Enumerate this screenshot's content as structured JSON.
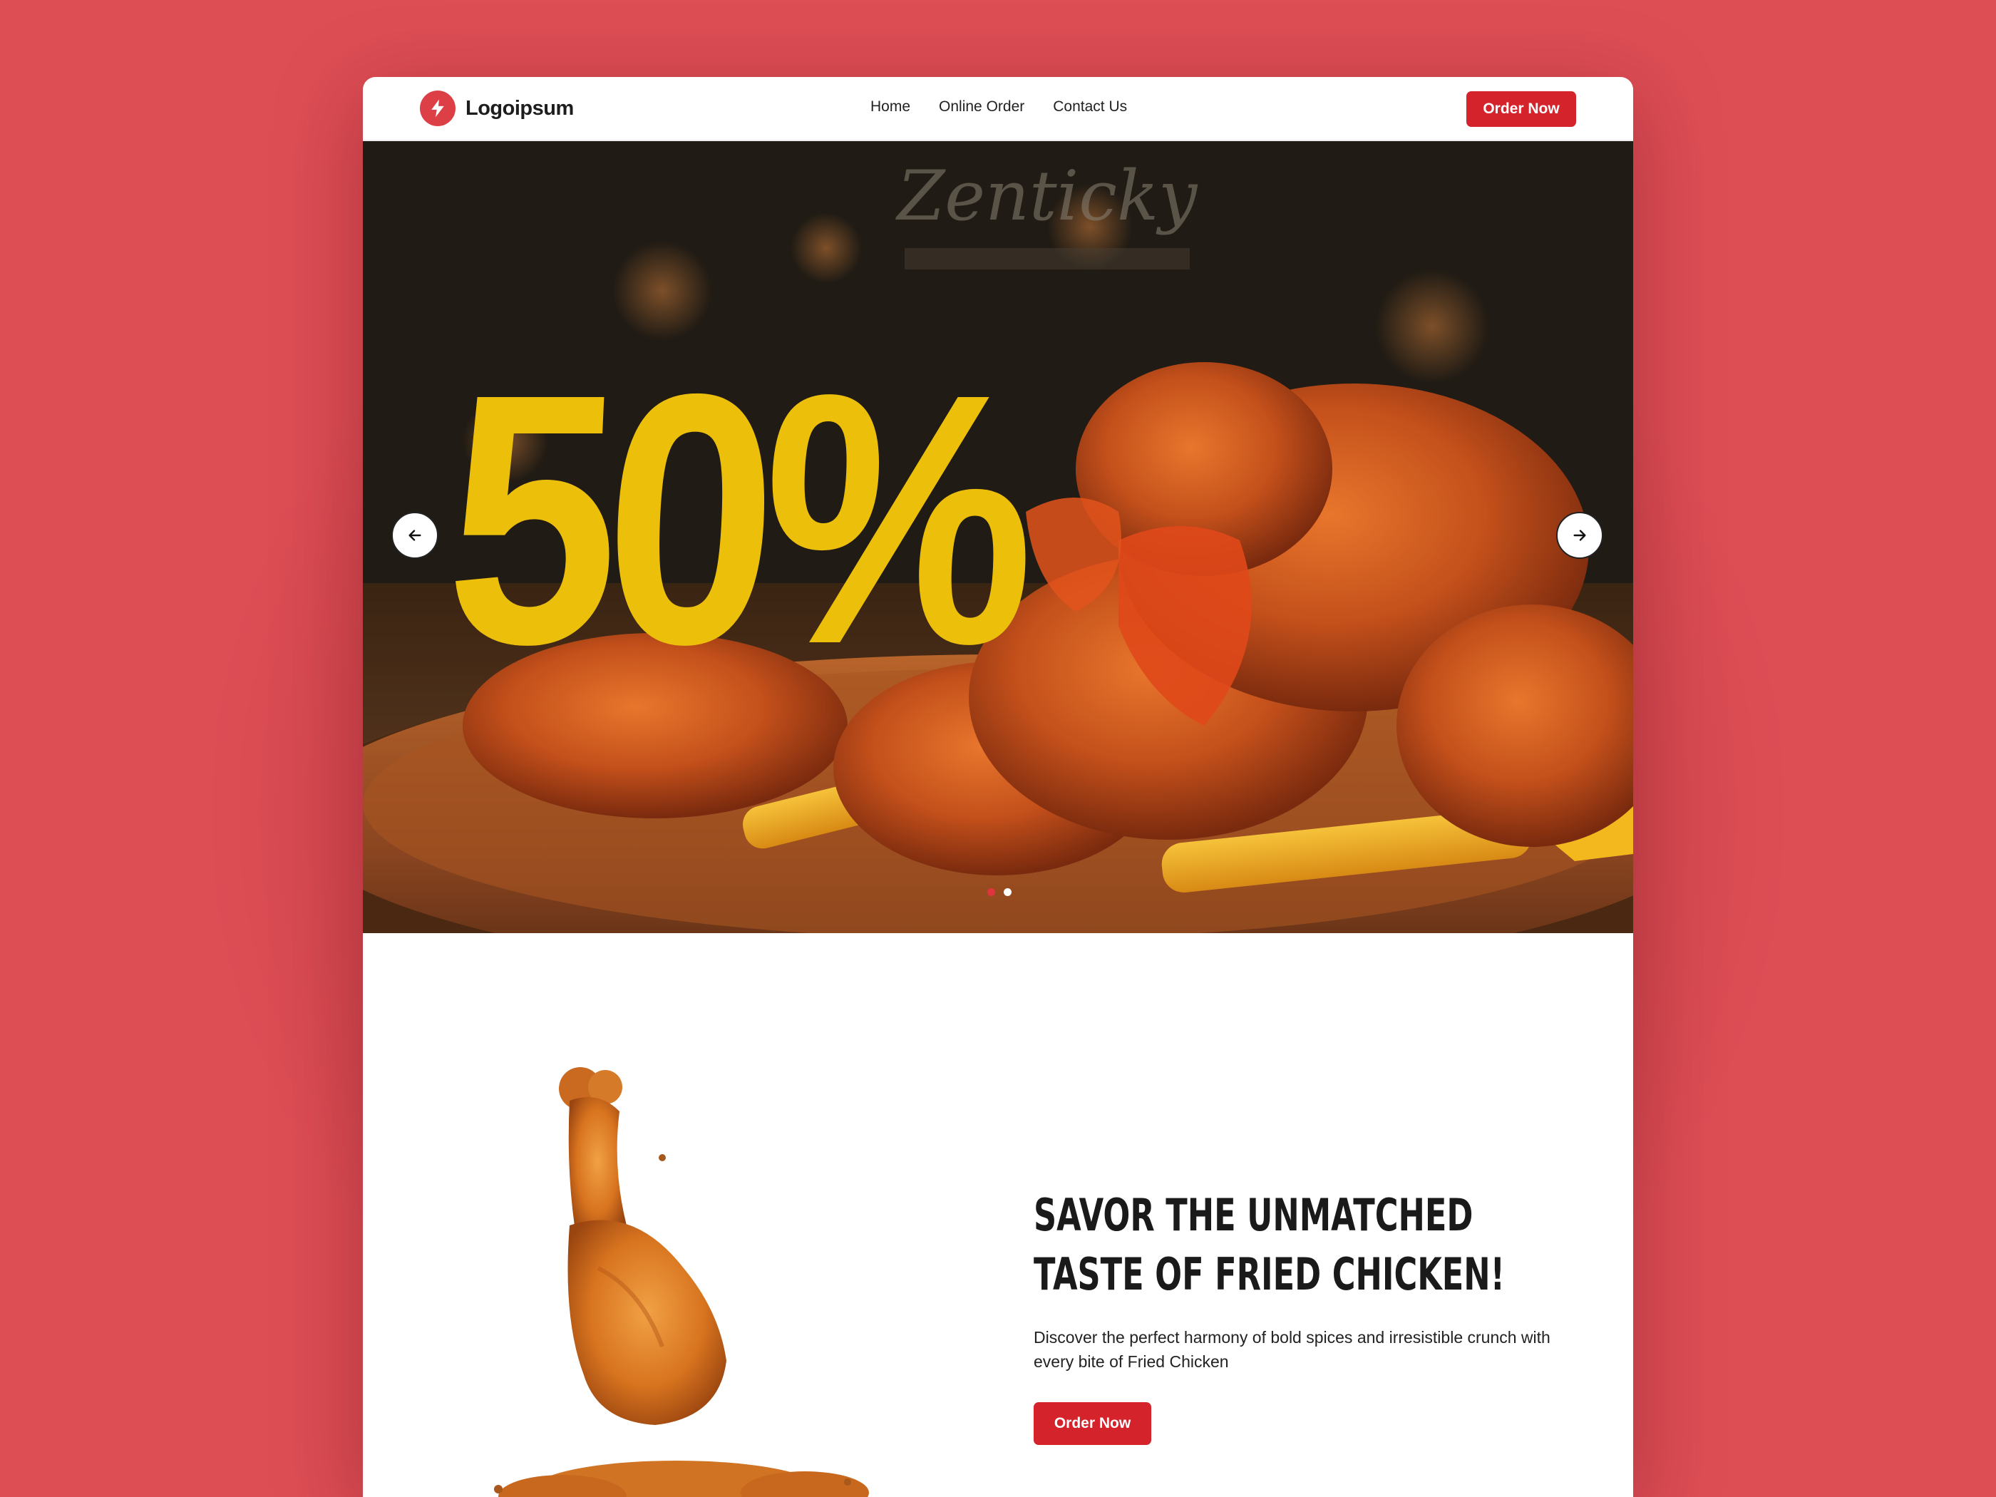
{
  "brand": {
    "name": "Logoipsum",
    "accent": "#d5232c",
    "logo_icon": "lightning-bolt-icon"
  },
  "nav": {
    "links": [
      "Home",
      "Online Order",
      "Contact Us"
    ],
    "cta_label": "Order Now"
  },
  "hero": {
    "headline": "50%",
    "headline_color": "#ecbf0a",
    "background_sign_text": "Zenticky",
    "prev_icon": "arrow-left-icon",
    "next_icon": "arrow-right-icon",
    "slides": {
      "count": 2,
      "active_index": 0
    },
    "dot_colors": {
      "active": "#e0353e",
      "inactive": "#ffffff"
    }
  },
  "feature": {
    "title": "Savor the unmatched taste of Fried Chicken!",
    "description": "Discover the perfect harmony of bold spices and irresistible crunch with every bite of Fried Chicken",
    "cta_label": "Order Now"
  }
}
